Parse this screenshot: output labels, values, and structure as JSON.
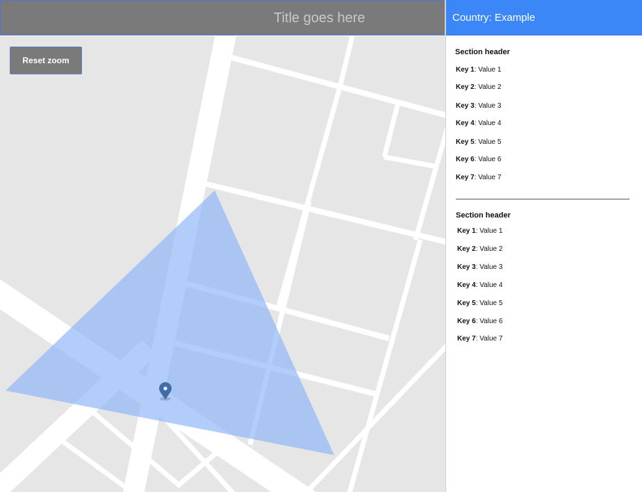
{
  "header": {
    "title": "Title goes here",
    "country": "Country: Example"
  },
  "map": {
    "reset_zoom_label": "Reset zoom",
    "colors": {
      "land": "#e6e6e6",
      "road": "#ffffff",
      "area_fill": "#8fb6f7",
      "marker": "#3f6ea8"
    }
  },
  "panel": {
    "sections": [
      {
        "header": "Section header",
        "items": [
          {
            "key": "Key 1",
            "value": "Value 1"
          },
          {
            "key": "Key 2",
            "value": "Value 2"
          },
          {
            "key": "Key 3",
            "value": "Value 3"
          },
          {
            "key": "Key 4",
            "value": "Value 4"
          },
          {
            "key": "Key 5",
            "value": "Value 5"
          },
          {
            "key": "Key 6",
            "value": "Value 6"
          },
          {
            "key": "Key 7",
            "value": "Value 7"
          }
        ]
      },
      {
        "header": "Section header",
        "items": [
          {
            "key": "Key 1",
            "value": "Value 1"
          },
          {
            "key": "Key 2",
            "value": "Value 2"
          },
          {
            "key": "Key 3",
            "value": "Value 3"
          },
          {
            "key": "Key 4",
            "value": "Value 4"
          },
          {
            "key": "Key 5",
            "value": "Value 5"
          },
          {
            "key": "Key 6",
            "value": "Value 6"
          },
          {
            "key": "Key 7",
            "value": "Value 7"
          }
        ]
      }
    ]
  }
}
